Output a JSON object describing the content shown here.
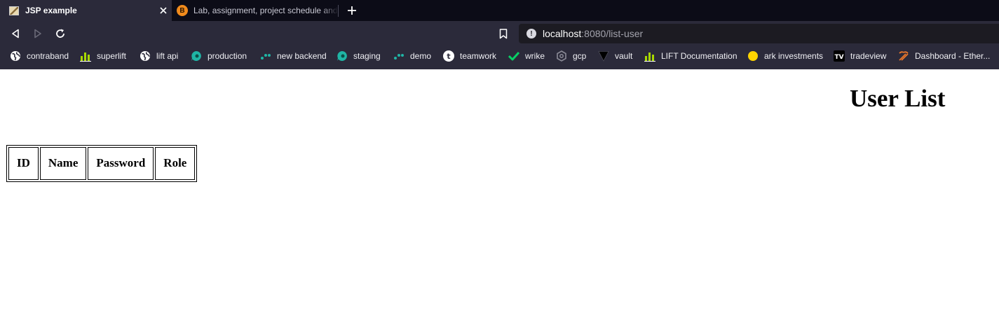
{
  "browser": {
    "tabs": [
      {
        "label": "JSP example",
        "active": true
      },
      {
        "label": "Lab, assignment, project schedule and",
        "active": false
      }
    ],
    "url": {
      "host": "localhost",
      "rest": ":8080/list-user"
    }
  },
  "bookmarks": [
    {
      "label": "contraband",
      "icon": "globe-icon"
    },
    {
      "label": "superlift",
      "icon": "lift-logo-icon"
    },
    {
      "label": "lift api",
      "icon": "globe-icon"
    },
    {
      "label": "production",
      "icon": "teal-bubble-icon"
    },
    {
      "label": "new backend",
      "icon": "dots-icon"
    },
    {
      "label": "staging",
      "icon": "teal-bubble-icon"
    },
    {
      "label": "demo",
      "icon": "dots-icon"
    },
    {
      "label": "teamwork",
      "icon": "teamwork-icon"
    },
    {
      "label": "wrike",
      "icon": "check-icon"
    },
    {
      "label": "gcp",
      "icon": "gear-icon"
    },
    {
      "label": "vault",
      "icon": "triangle-icon"
    },
    {
      "label": "LIFT Documentation",
      "icon": "lift-logo-icon"
    },
    {
      "label": "ark investments",
      "icon": "yellow-circle-icon"
    },
    {
      "label": "tradeview",
      "icon": "tradingview-icon"
    },
    {
      "label": "Dashboard - Ether...",
      "icon": "hammer-pick-icon"
    }
  ],
  "page": {
    "title": "User List",
    "table": {
      "headers": [
        "ID",
        "Name",
        "Password",
        "Role"
      ],
      "rows": []
    }
  },
  "colors": {
    "tabstrip": "#0c0c17",
    "toolbar": "#2b2a3a",
    "urlbar": "#1c1b22",
    "teal": "#1fb5a5",
    "lift_green": "#a8d800",
    "wrike_green": "#08cf65",
    "ark_yellow": "#ffd400",
    "hammer_orange": "#e8762b"
  }
}
